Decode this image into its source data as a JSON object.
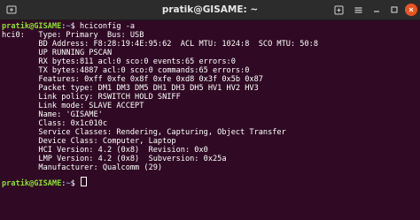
{
  "window": {
    "title": "pratik@GISAME: ~"
  },
  "icons": {
    "new_tab": "new-tab-icon",
    "menu": "hamburger-menu-icon",
    "minimize": "minimize-icon",
    "maximize": "maximize-icon",
    "close": "close-icon"
  },
  "colors": {
    "background": "#300a24",
    "prompt_user": "#8ae234",
    "prompt_path": "#729fcf",
    "text": "#ffffff",
    "close_button": "#e95420"
  },
  "terminal": {
    "prompt1": {
      "user": "pratik@GISAME",
      "sep": ":",
      "path": "~",
      "symbol": "$ ",
      "command": "hciconfig -a"
    },
    "output": [
      "hci0:   Type: Primary  Bus: USB",
      "        BD Address: F8:28:19:4E:95:62  ACL MTU: 1024:8  SCO MTU: 50:8",
      "        UP RUNNING PSCAN",
      "        RX bytes:811 acl:0 sco:0 events:65 errors:0",
      "        TX bytes:4887 acl:0 sco:0 commands:65 errors:0",
      "        Features: 0xff 0xfe 0x8f 0xfe 0xd8 0x3f 0x5b 0x87",
      "        Packet type: DM1 DM3 DM5 DH1 DH3 DH5 HV1 HV2 HV3",
      "        Link policy: RSWITCH HOLD SNIFF",
      "        Link mode: SLAVE ACCEPT",
      "        Name: 'GISAME'",
      "        Class: 0x1c010c",
      "        Service Classes: Rendering, Capturing, Object Transfer",
      "        Device Class: Computer, Laptop",
      "        HCI Version: 4.2 (0x8)  Revision: 0x0",
      "        LMP Version: 4.2 (0x8)  Subversion: 0x25a",
      "        Manufacturer: Qualcomm (29)",
      ""
    ],
    "prompt2": {
      "user": "pratik@GISAME",
      "sep": ":",
      "path": "~",
      "symbol": "$ "
    }
  }
}
